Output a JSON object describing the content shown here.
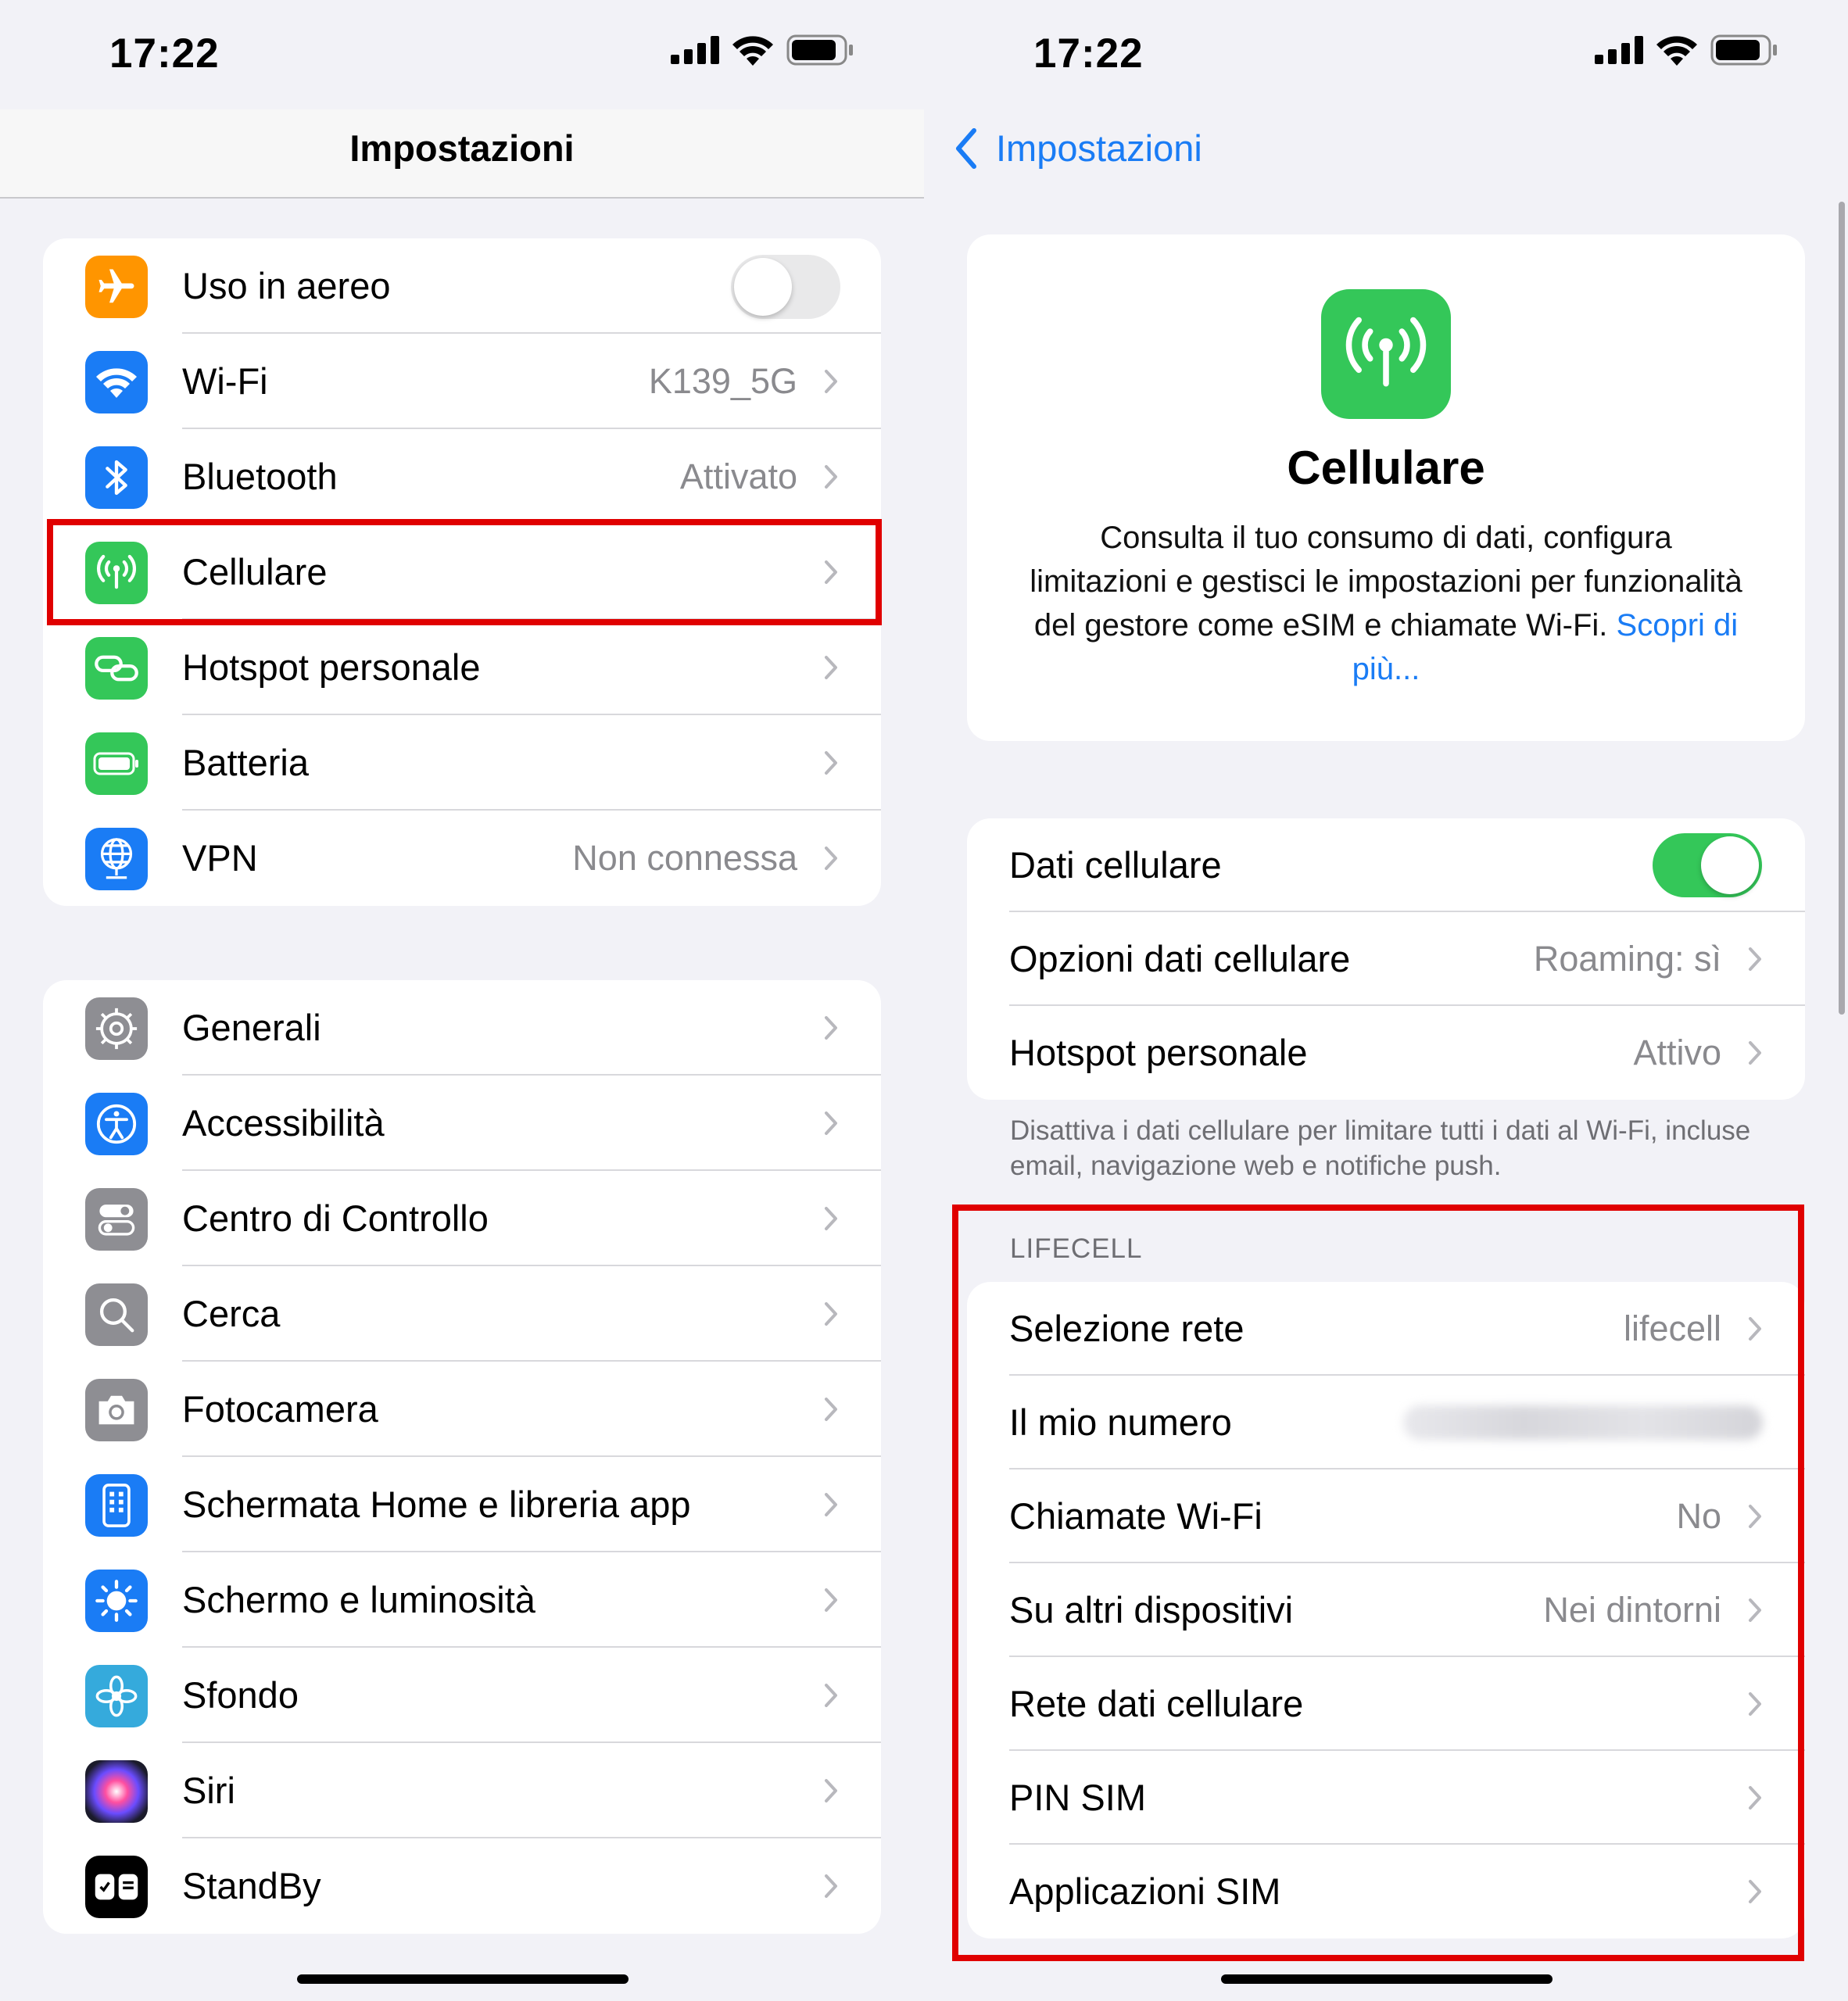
{
  "left": {
    "status": {
      "time": "17:22"
    },
    "nav": {
      "title": "Impostazioni"
    },
    "group1": [
      {
        "label": "Uso in aereo",
        "icon": "airplane-icon",
        "color": "#ff9500",
        "toggle": false
      },
      {
        "label": "Wi-Fi",
        "value": "K139_5G",
        "icon": "wifi-icon",
        "color": "#1a7cf5"
      },
      {
        "label": "Bluetooth",
        "value": "Attivato",
        "icon": "bluetooth-icon",
        "color": "#1a7cf5"
      },
      {
        "label": "Cellulare",
        "icon": "antenna-icon",
        "color": "#34c759"
      },
      {
        "label": "Hotspot personale",
        "icon": "link-icon",
        "color": "#34c759"
      },
      {
        "label": "Batteria",
        "icon": "battery-icon",
        "color": "#34c759"
      },
      {
        "label": "VPN",
        "value": "Non connessa",
        "icon": "globe-icon",
        "color": "#1a7cf5"
      }
    ],
    "group2": [
      {
        "label": "Generali",
        "icon": "gear-icon",
        "color": "#8e8e93"
      },
      {
        "label": "Accessibilità",
        "icon": "accessibility-icon",
        "color": "#1a7cf5"
      },
      {
        "label": "Centro di Controllo",
        "icon": "switches-icon",
        "color": "#8e8e93"
      },
      {
        "label": "Cerca",
        "icon": "search-icon",
        "color": "#8e8e93"
      },
      {
        "label": "Fotocamera",
        "icon": "camera-icon",
        "color": "#8e8e93"
      },
      {
        "label": "Schermata Home e libreria app",
        "icon": "phone-grid-icon",
        "color": "#1a7cf5"
      },
      {
        "label": "Schermo e luminosità",
        "icon": "sun-icon",
        "color": "#1a7cf5"
      },
      {
        "label": "Sfondo",
        "icon": "flower-icon",
        "color": "#35aadc"
      },
      {
        "label": "Siri",
        "icon": "siri-icon",
        "color": "#2b2b3a"
      },
      {
        "label": "StandBy",
        "icon": "standby-icon",
        "color": "#000000"
      }
    ]
  },
  "right": {
    "status": {
      "time": "17:22"
    },
    "nav": {
      "back_label": "Impostazioni"
    },
    "hero": {
      "title": "Cellulare",
      "description": "Consulta il tuo consumo di dati, configura limitazioni e gestisci le impostazioni per funzionalità del gestore come eSIM e chiamate Wi-Fi.",
      "link": "Scopri di più..."
    },
    "data_group": [
      {
        "label": "Dati cellulare",
        "toggle": true
      },
      {
        "label": "Opzioni dati cellulare",
        "value": "Roaming: sì"
      },
      {
        "label": "Hotspot personale",
        "value": "Attivo"
      }
    ],
    "footnote": "Disattiva i dati cellulare per limitare tutti i dati al Wi-Fi, incluse email, navigazione web e notifiche push.",
    "section_header": "LIFECELL",
    "sim_group": [
      {
        "label": "Selezione rete",
        "value": "lifecell"
      },
      {
        "label": "Il mio numero",
        "blurred": true
      },
      {
        "label": "Chiamate Wi-Fi",
        "value": "No"
      },
      {
        "label": "Su altri dispositivi",
        "value": "Nei dintorni"
      },
      {
        "label": "Rete dati cellulare"
      },
      {
        "label": "PIN SIM"
      },
      {
        "label": "Applicazioni SIM"
      }
    ]
  }
}
